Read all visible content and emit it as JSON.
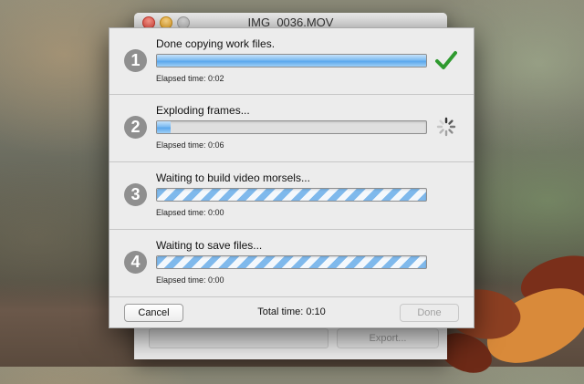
{
  "window": {
    "title": "IMG_0036.MOV",
    "export_label": "Export..."
  },
  "steps": [
    {
      "number": "1",
      "title": "Done copying work files.",
      "elapsed": "Elapsed time: 0:02",
      "state": "done",
      "progress": 1.0,
      "icon": "checkmark-icon"
    },
    {
      "number": "2",
      "title": "Exploding frames...",
      "elapsed": "Elapsed time: 0:06",
      "state": "active",
      "progress": 0.05,
      "icon": "spinner-icon"
    },
    {
      "number": "3",
      "title": "Waiting to build video morsels...",
      "elapsed": "Elapsed time: 0:00",
      "state": "waiting",
      "progress": null
    },
    {
      "number": "4",
      "title": "Waiting to save files...",
      "elapsed": "Elapsed time: 0:00",
      "state": "waiting",
      "progress": null
    }
  ],
  "footer": {
    "cancel_label": "Cancel",
    "total_time": "Total time: 0:10",
    "done_label": "Done"
  },
  "colors": {
    "accent": "#5aa7ec",
    "check": "#2f9a2f",
    "step_circle": "#8f8f8f"
  }
}
